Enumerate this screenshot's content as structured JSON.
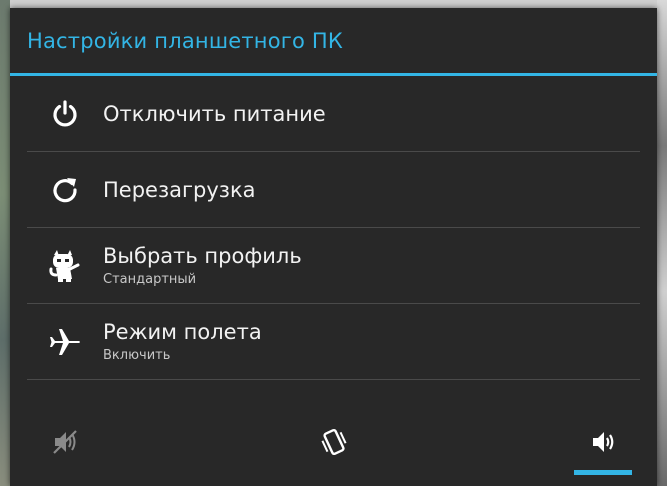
{
  "dialog": {
    "title": "Настройки планшетного ПК"
  },
  "menu": {
    "items": [
      {
        "label": "Отключить питание",
        "sublabel": "",
        "icon": "power-icon"
      },
      {
        "label": "Перезагрузка",
        "sublabel": "",
        "icon": "reboot-icon"
      },
      {
        "label": "Выбрать профиль",
        "sublabel": "Стандартный",
        "icon": "profile-mascot-icon"
      },
      {
        "label": "Режим полета",
        "sublabel": "Включить",
        "icon": "airplane-icon"
      }
    ]
  },
  "sound_modes": {
    "options": [
      {
        "name": "silent",
        "icon": "silent-icon"
      },
      {
        "name": "vibrate",
        "icon": "vibrate-icon"
      },
      {
        "name": "sound",
        "icon": "speaker-icon"
      }
    ],
    "selected": "sound"
  },
  "colors": {
    "accent": "#33b5e5",
    "dialog_bg": "#282828",
    "text_primary": "#f2f2f2",
    "text_secondary": "#c8c8c8",
    "divider": "#4a4a4a"
  }
}
